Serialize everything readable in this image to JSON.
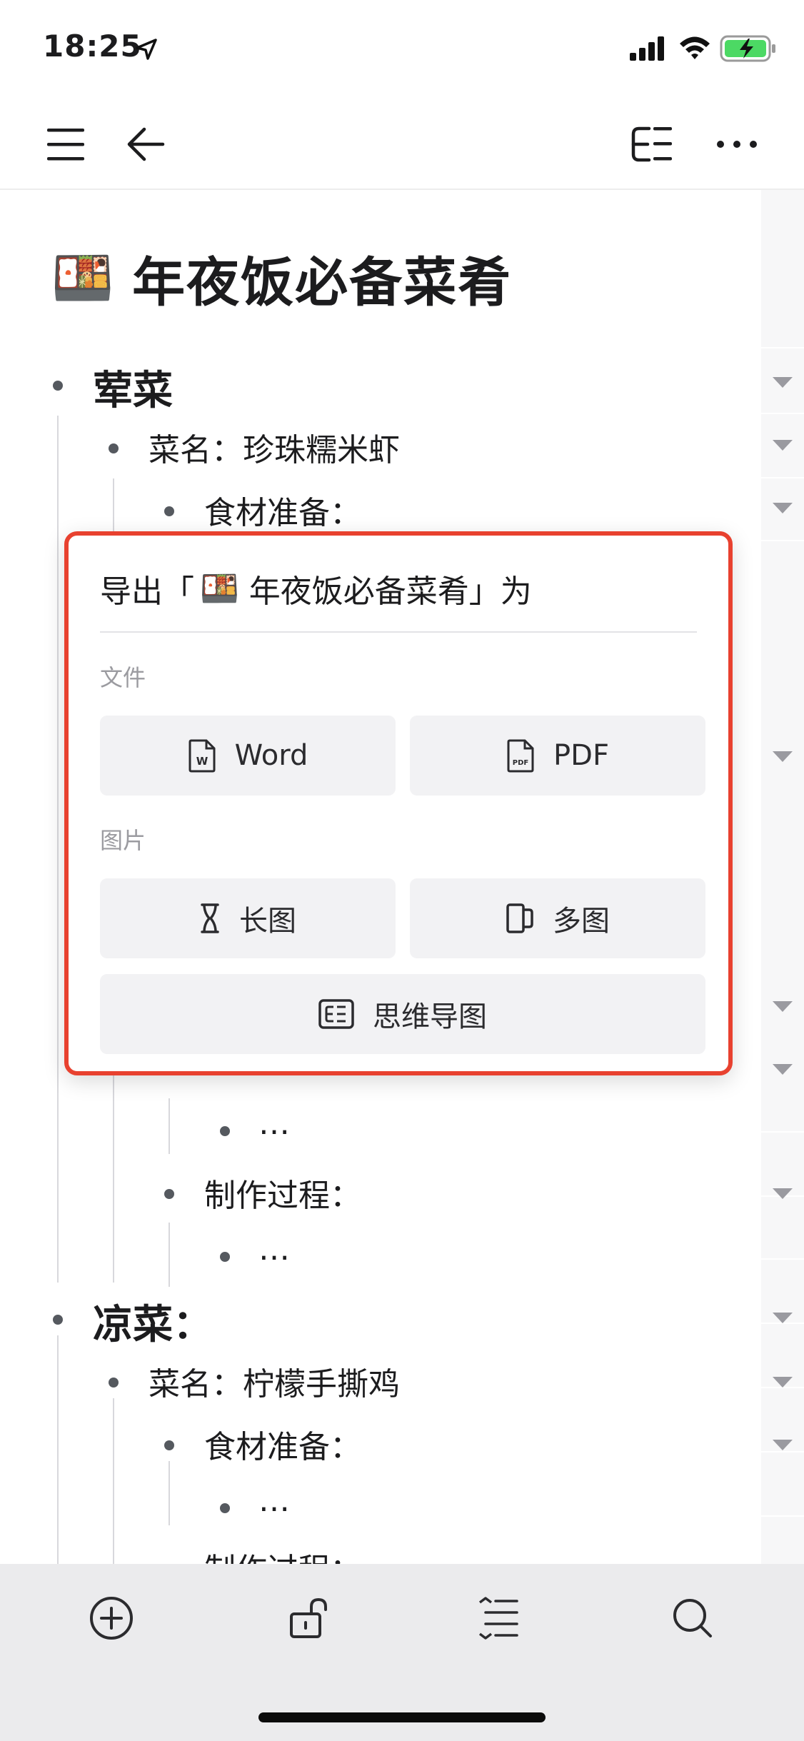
{
  "status_bar": {
    "time": "18:25"
  },
  "toolbar": {
    "menu_icon": "hamburger-menu-icon",
    "back_icon": "arrow-left-icon",
    "mindmap_icon": "mindmap-icon",
    "more_icon": "ellipsis-icon"
  },
  "document": {
    "title_emoji": "🍱",
    "title": "年夜饭必备菜肴",
    "nodes": [
      {
        "level": 1,
        "text": "荤菜"
      },
      {
        "level": 2,
        "text": "菜名：珍珠糯米虾"
      },
      {
        "level": 3,
        "text": "食材准备："
      },
      {
        "level": 4,
        "text": "…"
      },
      {
        "level": 3,
        "text": "制作过程："
      },
      {
        "level": 4,
        "text": "…"
      },
      {
        "level": 1,
        "text": "凉菜："
      },
      {
        "level": 2,
        "text": "菜名：柠檬手撕鸡"
      },
      {
        "level": 3,
        "text": "食材准备："
      },
      {
        "level": 4,
        "text": "…"
      },
      {
        "level": 3,
        "text": "制作过程："
      }
    ]
  },
  "export_dialog": {
    "title_prefix": "导出「",
    "title_emoji": "🍱",
    "title_name": "年夜饭必备菜肴",
    "title_suffix": "」为",
    "file_section": "文件",
    "word_label": "Word",
    "pdf_label": "PDF",
    "image_section": "图片",
    "long_image_label": "长图",
    "multi_image_label": "多图",
    "mindmap_label": "思维导图",
    "highlight_color": "#e8412f"
  },
  "bottom_toolbar": {
    "add_icon": "plus-circle-icon",
    "lock_icon": "unlock-icon",
    "indent_icon": "collapse-expand-icon",
    "search_icon": "search-icon"
  }
}
